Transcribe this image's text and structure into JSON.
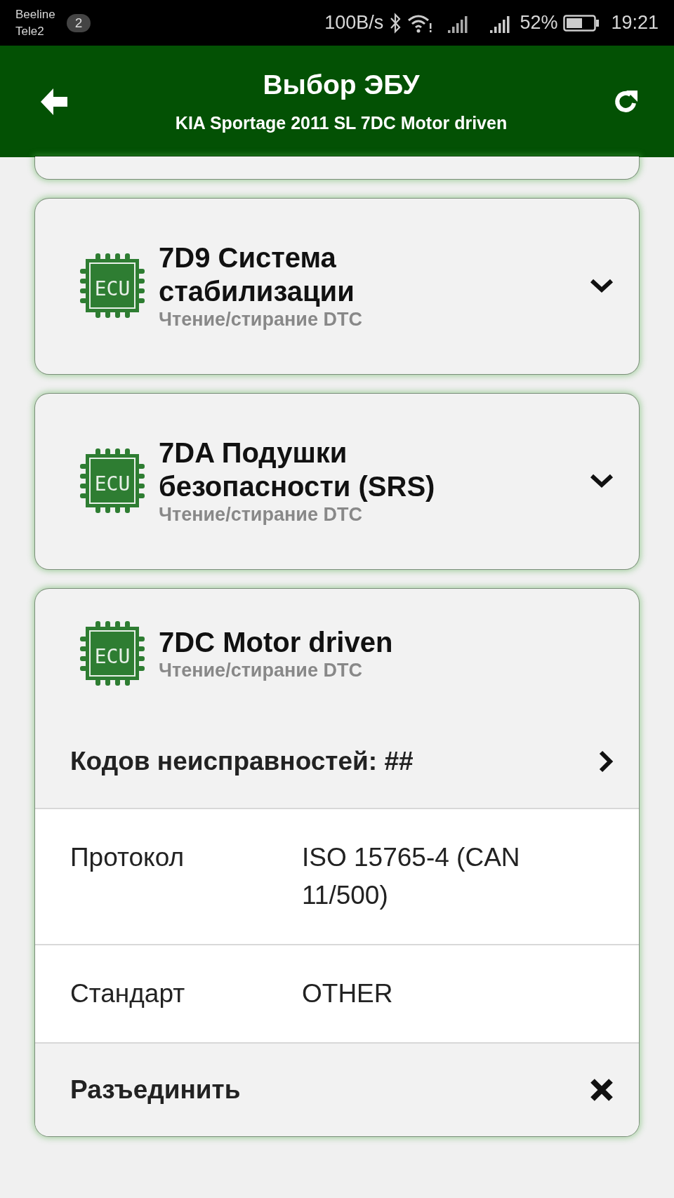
{
  "status_bar": {
    "carriers": [
      "Beeline",
      "Tele2"
    ],
    "sim_badge": "2",
    "net_speed": "100B/s",
    "battery_percent": "52%",
    "time": "19:21"
  },
  "header": {
    "title": "Выбор ЭБУ",
    "subtitle": "KIA Sportage 2011 SL 7DC Motor driven"
  },
  "ecus": [
    {
      "title": "7D9 Система стабилизации",
      "subtitle": "Чтение/стирание DTC",
      "icon_label": "ECU",
      "expanded": false
    },
    {
      "title": "7DA Подушки безопасности (SRS)",
      "subtitle": "Чтение/стирание DTC",
      "icon_label": "ECU",
      "expanded": false
    },
    {
      "title": "7DC Motor driven",
      "subtitle": "Чтение/стирание DTC",
      "icon_label": "ECU",
      "expanded": true,
      "rows": [
        {
          "kind": "link",
          "label": "Кодов неисправностей: ##"
        },
        {
          "kind": "info",
          "label": "Протокол",
          "value": "ISO 15765-4 (CAN 11/500)"
        },
        {
          "kind": "info",
          "label": "Стандарт",
          "value": "OTHER"
        },
        {
          "kind": "disconnect",
          "label": "Разъединить"
        }
      ]
    }
  ]
}
